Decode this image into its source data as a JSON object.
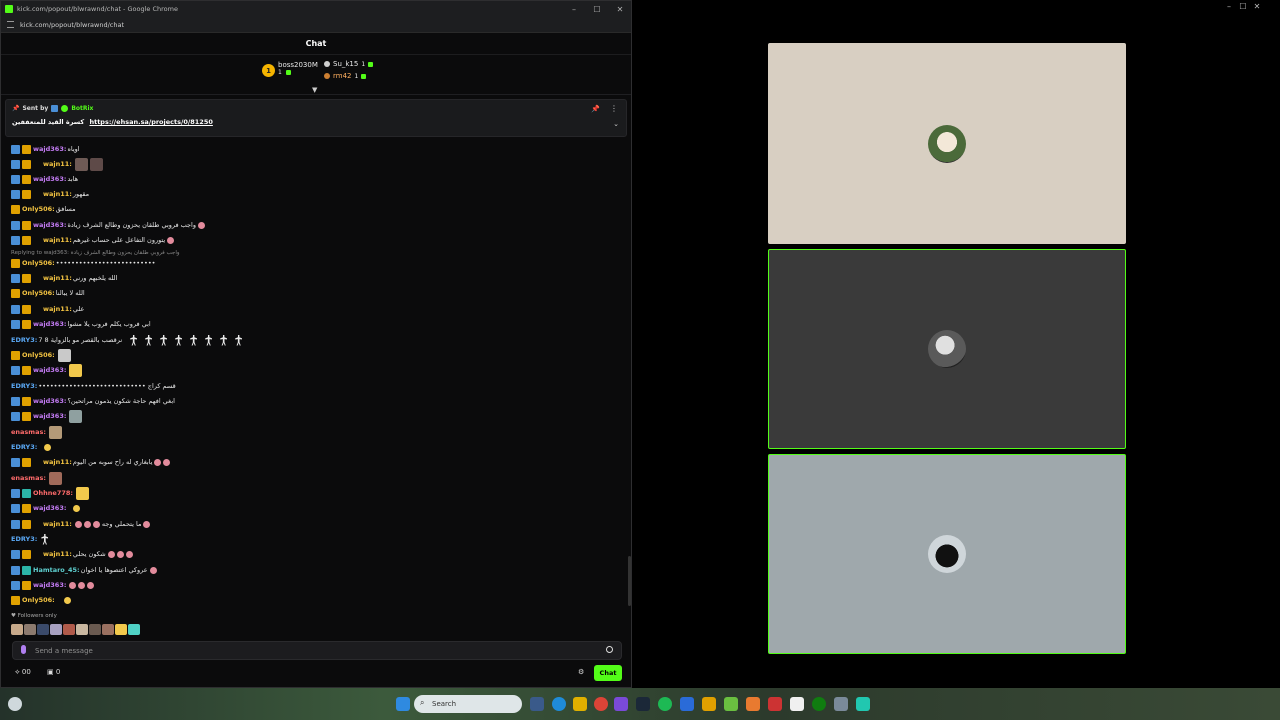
{
  "window": {
    "title": "kick.com/popout/blwrawnd/chat - Google Chrome",
    "url": "kick.com/popout/blwrawnd/chat"
  },
  "chat": {
    "header": "Chat",
    "leaderboard": [
      {
        "rank": "1",
        "name": "boss2030M",
        "count": "1"
      },
      {
        "name": "Su_k15",
        "count": "1"
      },
      {
        "name": "rm42",
        "count": "1"
      }
    ],
    "pinned": {
      "sent_by": "Sent by",
      "bot": "BotRix",
      "text": "كسرة القيد للمتعففين",
      "link": "https://ehsan.sa/projects/0/81250"
    },
    "reply_note": "Replying to wajd363: واجب فروبي طلقان يحزون وطالع الشرف زيادة",
    "messages": [
      {
        "user": "wajd363:",
        "text": "اوياه"
      },
      {
        "user": "wajn11:",
        "text": ""
      },
      {
        "user": "wajd363:",
        "text": "هابد"
      },
      {
        "user": "wajn11:",
        "text": "مقهور"
      },
      {
        "user": "Only506:",
        "text": "مسافق"
      },
      {
        "user": "wajd363:",
        "text": "واجب فروبي طلقان يحزون وطالع الشرف زيادة"
      },
      {
        "user": "wajn11:",
        "text": "يتورون التفاعل على حساب غيرهم"
      },
      {
        "user": "Only506:",
        "text": "••••••••••••••••••••••••••"
      },
      {
        "user": "wajn11:",
        "text": "الله يلخبهم ورني"
      },
      {
        "user": "Only506:",
        "text": "الله لا يبالنا"
      },
      {
        "user": "wajn11:",
        "text": "علي"
      },
      {
        "user": "wajd363:",
        "text": "ابي فروب يكلم فروب يلا مشوا"
      },
      {
        "user": "EDRY3:",
        "text": "7 8 نرقصب بالقصر مو بالزواية"
      },
      {
        "user": "Only506:",
        "text": ""
      },
      {
        "user": "wajd363:",
        "text": ""
      },
      {
        "user": "EDRY3:",
        "text": "•••••••••••••••••••••••••••• قسم كراج"
      },
      {
        "user": "wajd363:",
        "text": "ابغي افهم حاجة شكون يذمون مراتحين؟"
      },
      {
        "user": "wajd363:",
        "text": ""
      },
      {
        "user": "enasmas:",
        "text": ""
      },
      {
        "user": "EDRY3:",
        "text": ""
      },
      {
        "user": "wajn11:",
        "text": "يابغاري له راح سوبه من اليوم"
      },
      {
        "user": "enasmas:",
        "text": ""
      },
      {
        "user": "Ohhne778:",
        "text": ""
      },
      {
        "user": "wajd363:",
        "text": ""
      },
      {
        "user": "wajn11:",
        "text": "ما يتحملي وجه"
      },
      {
        "user": "EDRY3:",
        "text": ""
      },
      {
        "user": "wajn11:",
        "text": "شكون يحلي"
      },
      {
        "user": "Hamtaro_45:",
        "text": "عروكي اعتصوها يا اخوان"
      },
      {
        "user": "wajd363:",
        "text": ""
      },
      {
        "user": "Only506:",
        "text": ""
      }
    ],
    "followers_only": "Followers only",
    "input_placeholder": "Send a message",
    "bottom": {
      "count1": "00",
      "count2": "0",
      "chat_button": "Chat"
    }
  },
  "taskbar": {
    "search_placeholder": "Search"
  },
  "colors": {
    "accent": "#53fc18",
    "tile1": "#d8cfc2",
    "tile2": "#3a3a3a",
    "tile3": "#9fa8ac"
  }
}
